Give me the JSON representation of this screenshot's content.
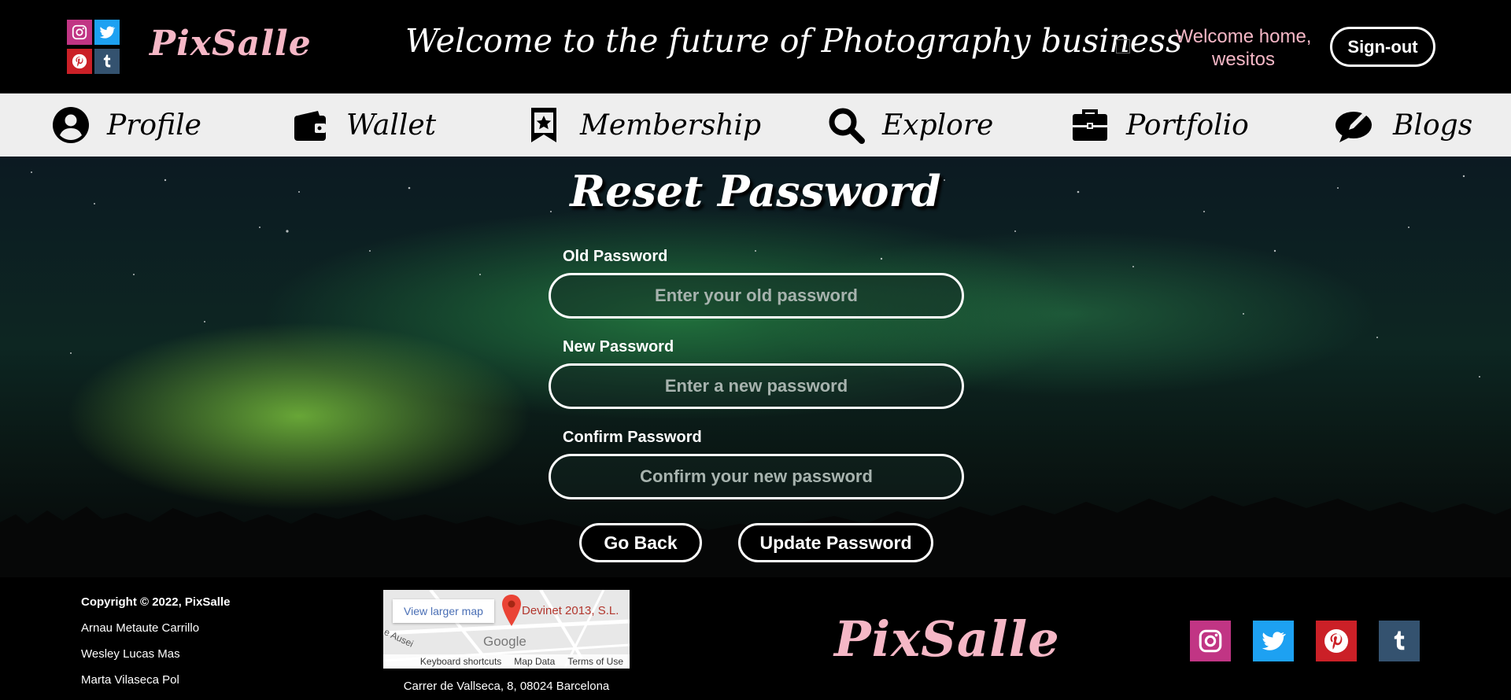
{
  "header": {
    "logo": "PixSalle",
    "slogan": "Welcome to the future of Photography business",
    "welcome": "Welcome home, wesitos",
    "signout_label": "Sign-out"
  },
  "nav": {
    "items": [
      {
        "label": "Profile",
        "icon": "user-icon"
      },
      {
        "label": "Wallet",
        "icon": "wallet-icon"
      },
      {
        "label": "Membership",
        "icon": "bookmark-star-icon"
      },
      {
        "label": "Explore",
        "icon": "search-icon"
      },
      {
        "label": "Portfolio",
        "icon": "briefcase-icon"
      },
      {
        "label": "Blogs",
        "icon": "comment-pen-icon"
      }
    ]
  },
  "form": {
    "title": "Reset Password",
    "old_label": "Old Password",
    "old_placeholder": "Enter your old password",
    "new_label": "New Password",
    "new_placeholder": "Enter a new password",
    "confirm_label": "Confirm Password",
    "confirm_placeholder": "Confirm your new password",
    "back_label": "Go Back",
    "update_label": "Update Password"
  },
  "footer": {
    "copyright": "Copyright © 2022, PixSalle",
    "authors": [
      "Arnau Metaute Carrillo",
      "Wesley Lucas Mas",
      "Marta Vilaseca Pol"
    ],
    "map": {
      "larger_link": "View larger map",
      "place": "Devinet 2013, S.L.",
      "brand": "Google",
      "street": "e Ausei",
      "shortcuts": "Keyboard shortcuts",
      "map_data": "Map Data",
      "terms": "Terms of Use"
    },
    "address": "Carrer de Vallseca, 8, 08024 Barcelona",
    "logo": "PixSalle"
  },
  "colors": {
    "brand_pink": "#f5b7c6",
    "instagram": "#c13584",
    "twitter": "#1da1f2",
    "pinterest": "#cb2027",
    "tumblr": "#34526f"
  }
}
